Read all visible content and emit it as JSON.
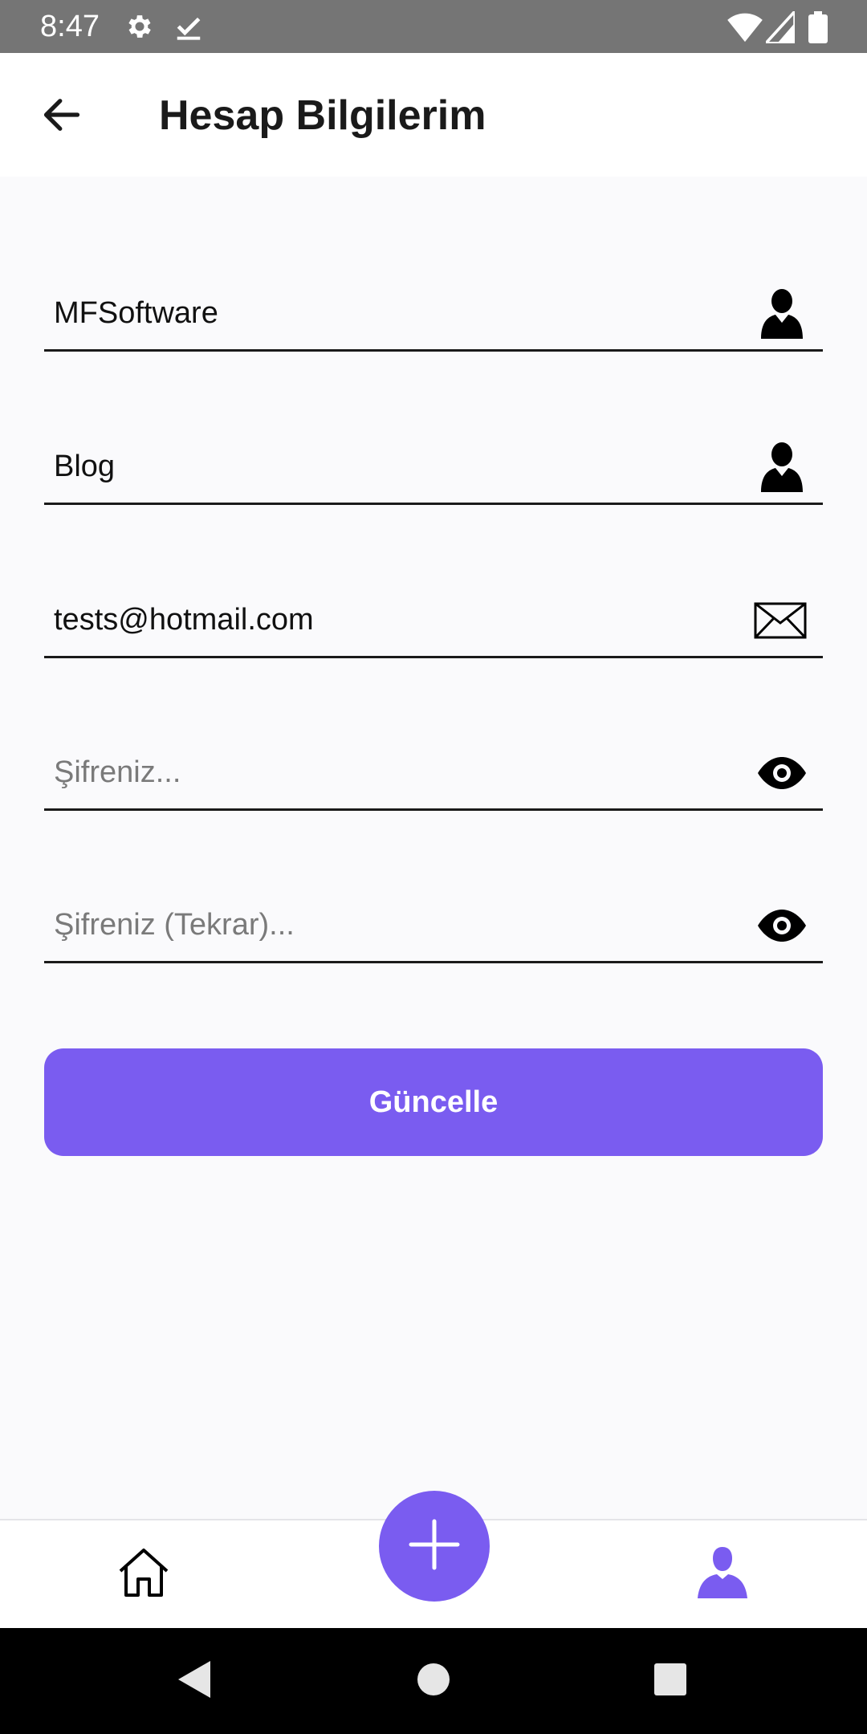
{
  "status_bar": {
    "time": "8:47",
    "icons": [
      "settings-icon",
      "check-download-icon",
      "wifi-icon",
      "signal-icon",
      "battery-icon"
    ]
  },
  "app_bar": {
    "title": "Hesap Bilgilerim",
    "back_icon": "arrow-left-icon"
  },
  "form": {
    "fields": [
      {
        "name": "first-name",
        "value": "MFSoftware",
        "placeholder": "",
        "icon": "user-icon"
      },
      {
        "name": "last-name",
        "value": "Blog",
        "placeholder": "",
        "icon": "user-icon"
      },
      {
        "name": "email",
        "value": "tests@hotmail.com",
        "placeholder": "",
        "icon": "envelope-icon"
      },
      {
        "name": "password",
        "value": "",
        "placeholder": "Şifreniz...",
        "icon": "eye-icon"
      },
      {
        "name": "password-repeat",
        "value": "",
        "placeholder": "Şifreniz (Tekrar)...",
        "icon": "eye-icon"
      }
    ],
    "submit_label": "Güncelle"
  },
  "bottom_nav": {
    "items": [
      {
        "name": "home",
        "icon": "home-icon",
        "active": false
      },
      {
        "name": "add",
        "icon": "plus-icon",
        "active": false
      },
      {
        "name": "profile",
        "icon": "person-icon",
        "active": true
      }
    ]
  },
  "colors": {
    "accent": "#7A5CF0",
    "background": "#FAFAFC",
    "status_bar": "#757575",
    "text": "#111111",
    "placeholder": "#7A7A7A"
  }
}
